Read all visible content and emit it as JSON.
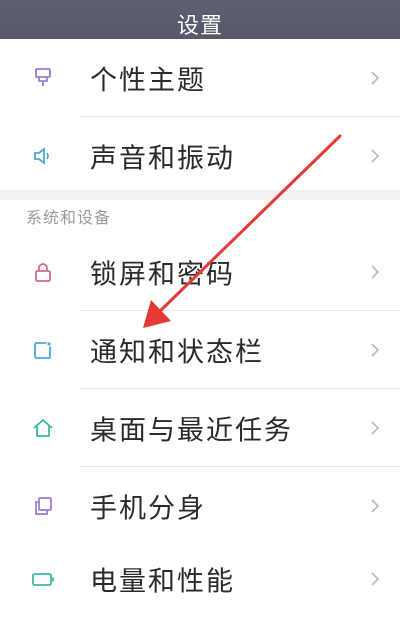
{
  "header": {
    "title": "设置"
  },
  "rows_top": [
    {
      "label": "个性主题",
      "icon": "theme-icon"
    },
    {
      "label": "声音和振动",
      "icon": "speaker-icon"
    }
  ],
  "section": {
    "title": "系统和设备"
  },
  "rows_system": [
    {
      "label": "锁屏和密码",
      "icon": "lock-icon"
    },
    {
      "label": "通知和状态栏",
      "icon": "notification-icon"
    },
    {
      "label": "桌面与最近任务",
      "icon": "home-icon"
    },
    {
      "label": "手机分身",
      "icon": "dual-app-icon"
    },
    {
      "label": "电量和性能",
      "icon": "battery-icon"
    }
  ],
  "colors": {
    "header_bg": "#5a5b6e",
    "arrow": "#e53935",
    "theme_icon": "#9c7fd4",
    "speaker_icon": "#4aa9d9",
    "lock_icon": "#d46b86",
    "notification_icon": "#4aa9d9",
    "home_icon": "#3fb8a0",
    "dual_app_icon": "#9c7fd4",
    "battery_icon": "#3fb8a0"
  }
}
